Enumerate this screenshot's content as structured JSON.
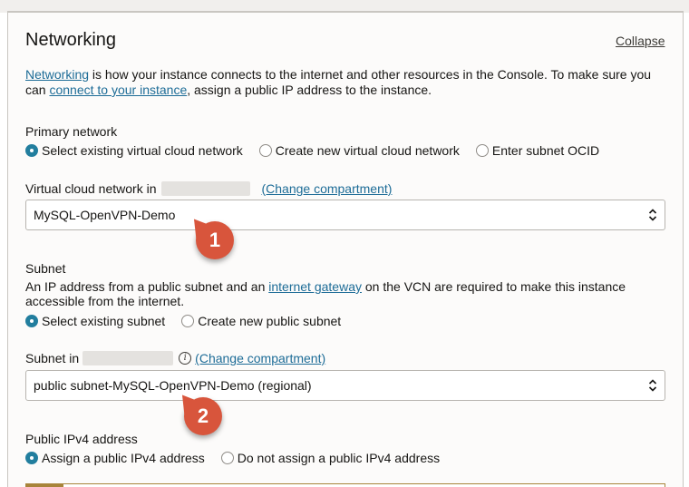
{
  "header": {
    "title": "Networking",
    "collapse_label": "Collapse"
  },
  "description": {
    "link1": "Networking",
    "text1": " is how your instance connects to the internet and other resources in the Console. To make sure you can ",
    "link2": "connect to your instance",
    "text2": ", assign a public IP address to the instance."
  },
  "primary_network": {
    "label": "Primary network",
    "options": [
      "Select existing virtual cloud network",
      "Create new virtual cloud network",
      "Enter subnet OCID"
    ],
    "selected_index": 0
  },
  "vcn": {
    "label": "Virtual cloud network in",
    "change_compartment": "(Change compartment)",
    "value": "MySQL-OpenVPN-Demo"
  },
  "subnet": {
    "label": "Subnet",
    "help_text1": "An IP address from a public subnet and an ",
    "help_link": "internet gateway",
    "help_text2": " on the VCN are required to make this instance accessible from the internet.",
    "options": [
      "Select existing subnet",
      "Create new public subnet"
    ],
    "selected_index": 0,
    "in_label": "Subnet in",
    "info_glyph": "i",
    "change_compartment": "(Change compartment)",
    "value": "public subnet-MySQL-OpenVPN-Demo (regional)"
  },
  "public_ip": {
    "label": "Public IPv4 address",
    "options": [
      "Assign a public IPv4 address",
      "Do not assign a public IPv4 address"
    ],
    "selected_index": 0
  },
  "callouts": [
    "1",
    "2"
  ],
  "colors": {
    "accent": "#227e9e",
    "link": "#1d6c97",
    "callout": "#d8553c",
    "warning_bar": "#a8843a"
  }
}
